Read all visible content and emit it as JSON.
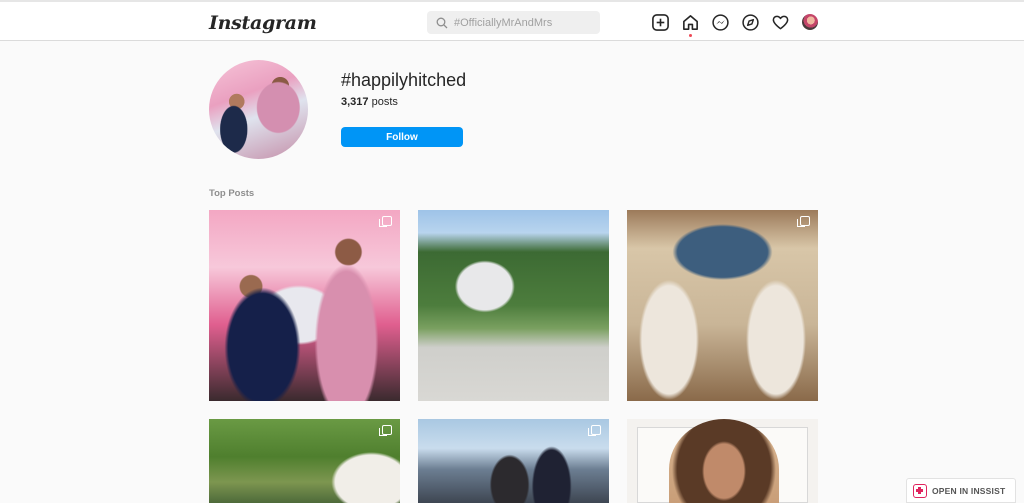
{
  "header": {
    "logo": "Instagram",
    "search": {
      "placeholder": "#OfficiallyMrAndMrs"
    },
    "nav": [
      "new-post-icon",
      "home-icon",
      "messenger-icon",
      "explore-icon",
      "activity-heart-icon",
      "profile-avatar"
    ]
  },
  "hashtag": {
    "name": "#happilyhitched",
    "posts_count": "3,317",
    "posts_label": "posts",
    "follow_label": "Follow"
  },
  "section": {
    "title": "Top Posts"
  },
  "posts": [
    {
      "alt": "Engagement ceremony photo",
      "multi": true
    },
    {
      "alt": "Family in front of house",
      "multi": false
    },
    {
      "alt": "Caravan interior",
      "multi": true
    },
    {
      "alt": "Caravan in park",
      "multi": true
    },
    {
      "alt": "Group at event",
      "multi": true
    },
    {
      "alt": "Portrait",
      "multi": false
    }
  ],
  "extension": {
    "label": "OPEN IN INSSIST"
  },
  "colors": {
    "accent": "#0095f6",
    "notification": "#ed4956",
    "inssist": "#e0245e"
  }
}
